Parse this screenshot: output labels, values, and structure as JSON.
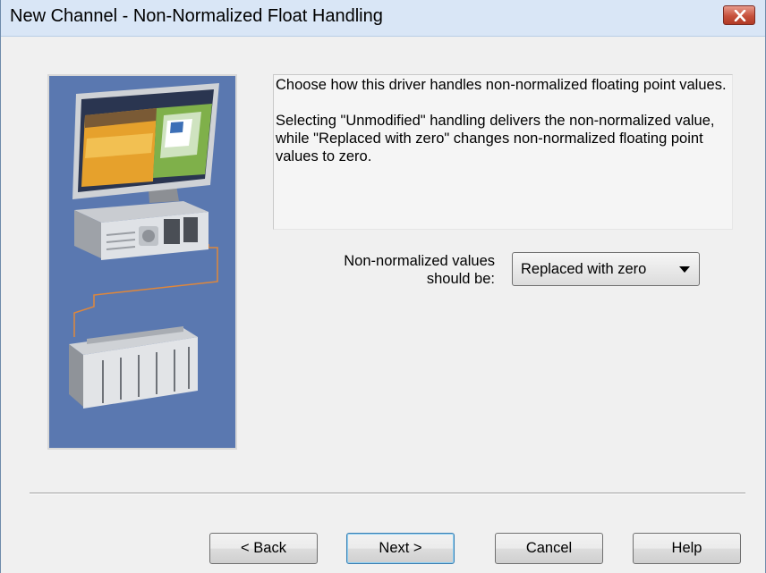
{
  "window": {
    "title": "New Channel - Non-Normalized Float Handling",
    "close_label": "×"
  },
  "description": {
    "paragraph1": "Choose how this driver handles non-normalized floating point values.",
    "paragraph2": "Selecting \"Unmodified\" handling delivers the non-normalized value, while \"Replaced with zero\" changes non-normalized floating point values to zero."
  },
  "field": {
    "label_line1": "Non-normalized values",
    "label_line2": "should be:",
    "selected_value": "Replaced with zero"
  },
  "buttons": {
    "back": "< Back",
    "next": "Next >",
    "cancel": "Cancel",
    "help": "Help"
  },
  "colors": {
    "titlebar": "#d9e6f6",
    "image_background": "#5876ae",
    "close_button": "#c6513c",
    "default_button_border": "#3c7fb1"
  },
  "icons": {
    "close": "close-icon",
    "dropdown": "chevron-down-icon",
    "illustration": "computer-plc-illustration"
  }
}
